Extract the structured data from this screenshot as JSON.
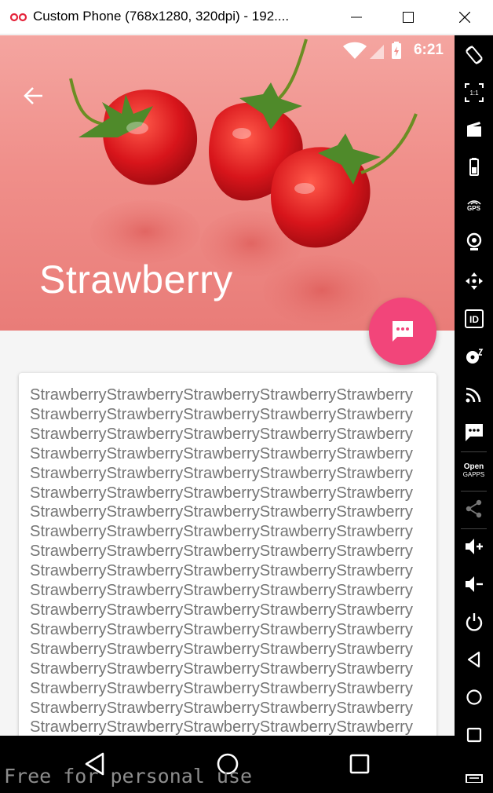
{
  "window": {
    "title": "Custom Phone (768x1280, 320dpi) - 192...."
  },
  "status_bar": {
    "time": "6:21"
  },
  "toolbar": {
    "title": "Strawberry"
  },
  "content": {
    "repeated_word": "Strawberry",
    "words_per_line": 5,
    "visible_lines": 18
  },
  "sidebar": {
    "items": [
      {
        "icon": "rotate-icon"
      },
      {
        "icon": "pixel-ratio-icon",
        "label": "1:1"
      },
      {
        "icon": "screen-record-icon"
      },
      {
        "icon": "battery-icon"
      },
      {
        "icon": "gps-icon",
        "label": "GPS"
      },
      {
        "icon": "camera-icon"
      },
      {
        "icon": "dpad-icon"
      },
      {
        "icon": "device-id-icon",
        "label": "ID"
      },
      {
        "icon": "disk-icon"
      },
      {
        "icon": "cast-icon"
      },
      {
        "icon": "sms-icon"
      },
      {
        "icon": "open-gapps-icon",
        "label_line1": "Open",
        "label_line2": "GAPPS"
      },
      {
        "icon": "share-icon"
      },
      {
        "icon": "volume-up-icon"
      },
      {
        "icon": "volume-down-icon"
      },
      {
        "icon": "power-icon"
      },
      {
        "icon": "back-icon"
      },
      {
        "icon": "home-icon"
      },
      {
        "icon": "recents-icon"
      },
      {
        "icon": "menu-icon"
      }
    ]
  },
  "watermark": "Free for personal use",
  "colors": {
    "accent": "#f2457a",
    "hero_background": "#f08f8a",
    "body_text": "#757575"
  }
}
